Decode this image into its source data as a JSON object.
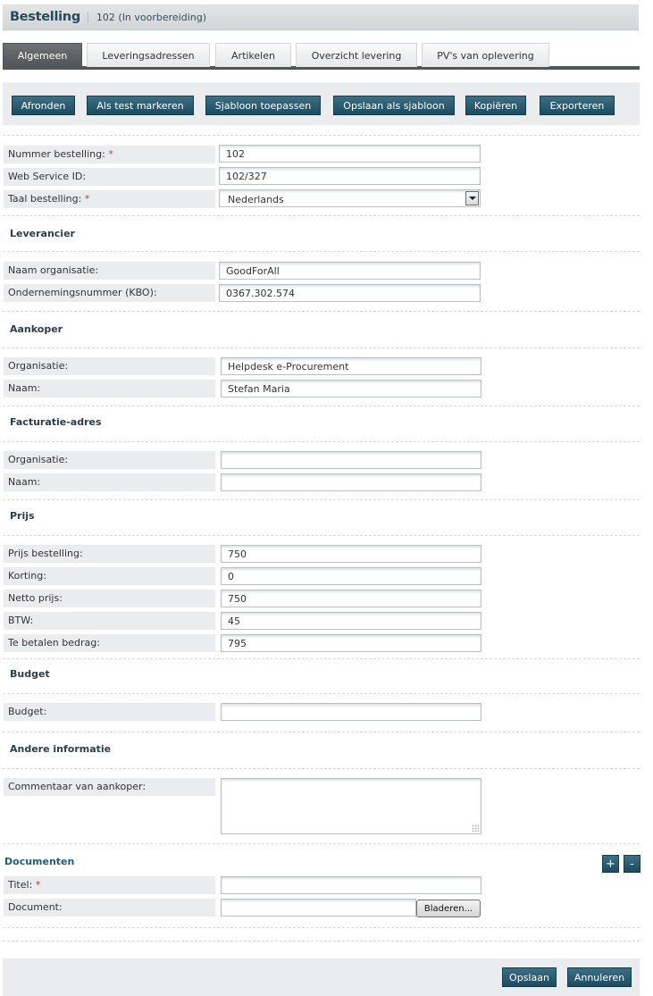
{
  "header": {
    "title": "Bestelling",
    "subtitle": "102 (In voorbereiding)"
  },
  "tabs": [
    {
      "label": "Algemeen",
      "active": true
    },
    {
      "label": "Leveringsadressen",
      "active": false
    },
    {
      "label": "Artikelen",
      "active": false
    },
    {
      "label": "Overzicht levering",
      "active": false
    },
    {
      "label": "PV's van oplevering",
      "active": false
    }
  ],
  "toolbar": {
    "buttons": [
      "Afronden",
      "Als test markeren",
      "Sjabloon toepassen",
      "Opslaan als sjabloon",
      "Kopiëren",
      "Exporteren"
    ]
  },
  "required_marker": "*",
  "general": {
    "order_number": {
      "label": "Nummer bestelling:",
      "value": "102",
      "required": true
    },
    "web_service_id": {
      "label": "Web Service ID:",
      "value": "102/327"
    },
    "language": {
      "label": "Taal bestelling:",
      "value": "Nederlands",
      "required": true
    }
  },
  "supplier": {
    "heading": "Leverancier",
    "org_name": {
      "label": "Naam organisatie:",
      "value": "GoodForAll"
    },
    "company_number": {
      "label": "Ondernemingsnummer (KBO):",
      "value": "0367.302.574"
    }
  },
  "buyer": {
    "heading": "Aankoper",
    "organisation": {
      "label": "Organisatie:",
      "value": "Helpdesk e-Procurement"
    },
    "name": {
      "label": "Naam:",
      "value": "Stefan Maria"
    }
  },
  "billing": {
    "heading": "Facturatie-adres",
    "organisation": {
      "label": "Organisatie:",
      "value": ""
    },
    "name": {
      "label": "Naam:",
      "value": ""
    }
  },
  "price": {
    "heading": "Prijs",
    "order_price": {
      "label": "Prijs bestelling:",
      "value": "750"
    },
    "discount": {
      "label": "Korting:",
      "value": "0"
    },
    "net_price": {
      "label": "Netto prijs:",
      "value": "750"
    },
    "vat": {
      "label": "BTW:",
      "value": "45"
    },
    "amount_due": {
      "label": "Te betalen bedrag:",
      "value": "795"
    }
  },
  "budget": {
    "heading": "Budget",
    "budget": {
      "label": "Budget:",
      "value": ""
    }
  },
  "other": {
    "heading": "Andere informatie",
    "buyer_comment": {
      "label": "Commentaar van aankoper:",
      "value": ""
    }
  },
  "documents": {
    "heading": "Documenten",
    "add_label": "+",
    "remove_label": "-",
    "title": {
      "label": "Titel:",
      "value": "",
      "required": true
    },
    "document": {
      "label": "Document:",
      "value": "",
      "browse_label": "Bladeren..."
    }
  },
  "footer": {
    "save_label": "Opslaan",
    "cancel_label": "Annuleren"
  }
}
